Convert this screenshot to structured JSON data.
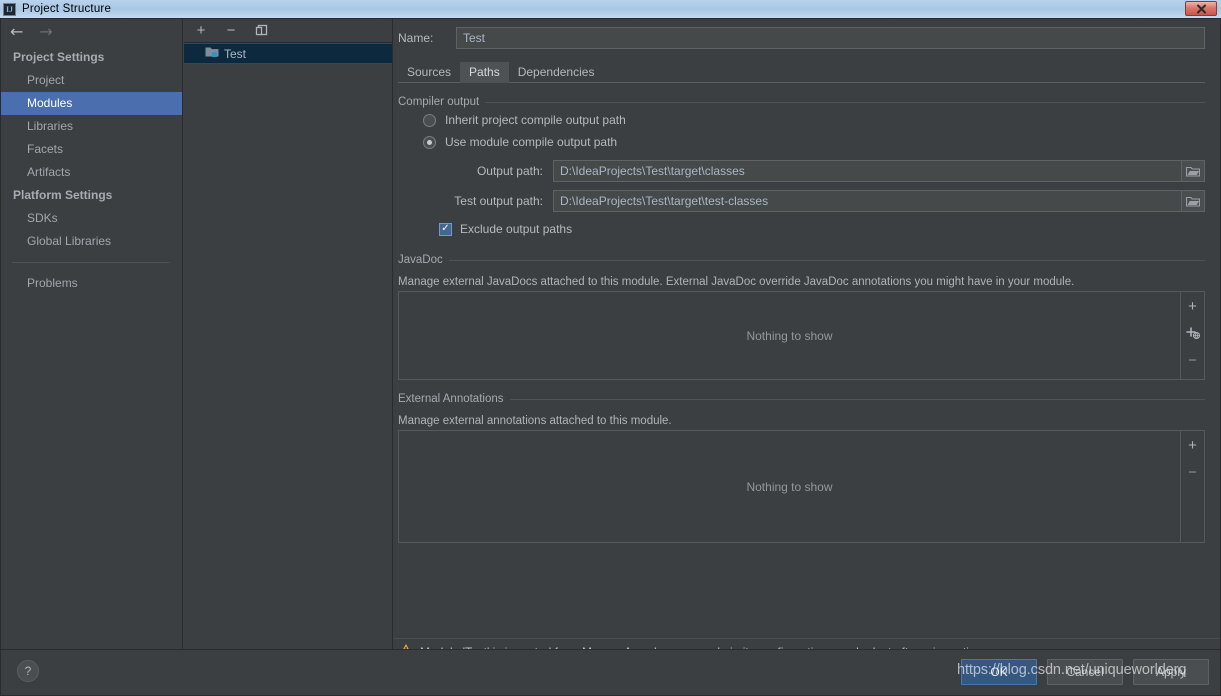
{
  "window": {
    "title": "Project Structure",
    "app_icon": "intellij-idea-icon",
    "close_label": "✕"
  },
  "nav": {
    "back": "←",
    "forward": "→"
  },
  "sidebar": {
    "groups": [
      {
        "title": "Project Settings",
        "items": [
          {
            "label": "Project",
            "selected": false
          },
          {
            "label": "Modules",
            "selected": true
          },
          {
            "label": "Libraries",
            "selected": false
          },
          {
            "label": "Facets",
            "selected": false
          },
          {
            "label": "Artifacts",
            "selected": false
          }
        ]
      },
      {
        "title": "Platform Settings",
        "items": [
          {
            "label": "SDKs",
            "selected": false
          },
          {
            "label": "Global Libraries",
            "selected": false
          }
        ]
      }
    ],
    "problems_label": "Problems"
  },
  "modules_panel": {
    "toolbar": {
      "add": "+",
      "remove": "−",
      "copy": "copy-icon"
    },
    "items": [
      {
        "label": "Test",
        "icon": "module-icon",
        "selected": true
      }
    ]
  },
  "name_field": {
    "label": "Name:",
    "value": "Test"
  },
  "tabs": [
    {
      "label": "Sources",
      "active": false
    },
    {
      "label": "Paths",
      "active": true
    },
    {
      "label": "Dependencies",
      "active": false
    }
  ],
  "compiler_output": {
    "title": "Compiler output",
    "options": [
      {
        "label": "Inherit project compile output path",
        "checked": false
      },
      {
        "label": "Use module compile output path",
        "checked": true
      }
    ],
    "output_path": {
      "label": "Output path:",
      "value": "D:\\IdeaProjects\\Test\\target\\classes",
      "browse_icon": "folder-icon"
    },
    "test_output_path": {
      "label": "Test output path:",
      "value": "D:\\IdeaProjects\\Test\\target\\test-classes",
      "browse_icon": "folder-icon"
    },
    "exclude_checkbox": {
      "label": "Exclude output paths",
      "checked": true,
      "tick": "✓"
    }
  },
  "javadoc": {
    "title": "JavaDoc",
    "description": "Manage external JavaDocs attached to this module. External JavaDoc override JavaDoc annotations you might have in your module.",
    "empty_text": "Nothing to show",
    "buttons": [
      {
        "name": "add-button",
        "glyph": "+"
      },
      {
        "name": "add-url-button",
        "glyph": "+"
      },
      {
        "name": "remove-button",
        "glyph": "−"
      }
    ]
  },
  "external_annotations": {
    "title": "External Annotations",
    "description": "Manage external annotations attached to this module.",
    "empty_text": "Nothing to show",
    "buttons": [
      {
        "name": "add-button",
        "glyph": "+"
      },
      {
        "name": "remove-button",
        "glyph": "−"
      }
    ]
  },
  "warning": {
    "icon": "warning-triangle-icon",
    "text": "Module 'Test' is imported from Maven. Any changes made in its configuration may be lost after reimporting."
  },
  "bottom": {
    "help_label": "?",
    "buttons": [
      {
        "label": "OK",
        "primary": true
      },
      {
        "label": "Cancel",
        "primary": false
      },
      {
        "label": "Apply",
        "primary": false
      }
    ]
  },
  "watermark": "https://blog.csdn.net/uniqueworlderq",
  "colors": {
    "background": "#3c3f41",
    "selection_blue": "#4b6eaf",
    "module_selected": "#0d293e",
    "accent_primary": "#365880",
    "warning_orange": "#f0a732",
    "titlebar": "#a8c7e6",
    "close_red": "#c9564c"
  }
}
